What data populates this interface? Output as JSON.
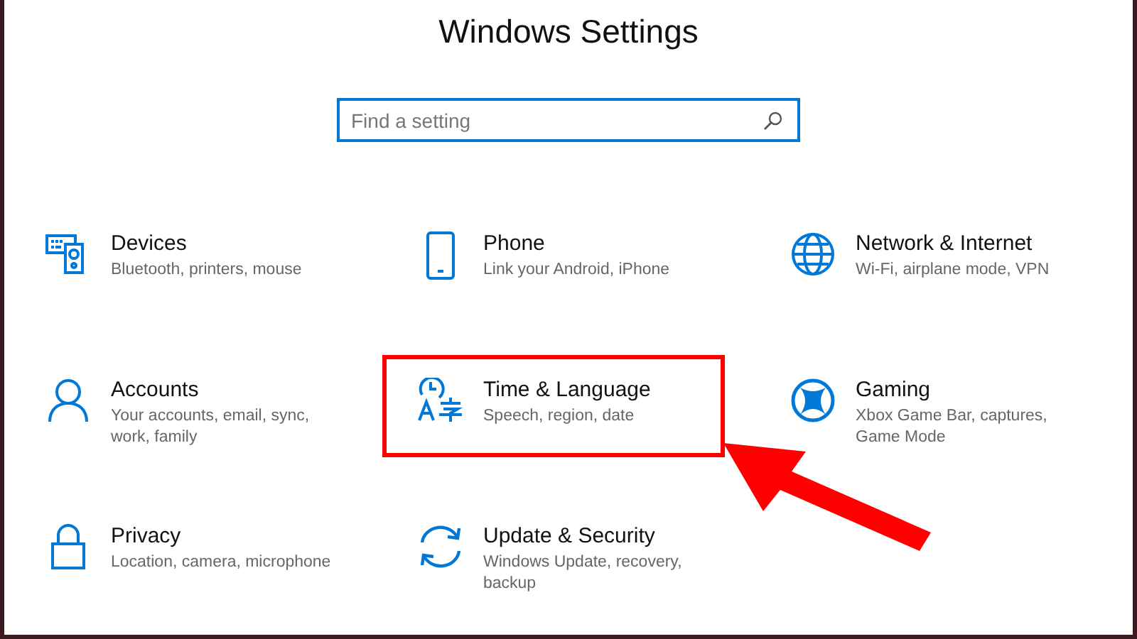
{
  "window": {
    "title": "Windows Settings"
  },
  "search": {
    "placeholder": "Find a setting"
  },
  "items": [
    {
      "kind": "devices",
      "title": "Devices",
      "description": "Bluetooth, printers, mouse",
      "highlighted": false
    },
    {
      "kind": "phone",
      "title": "Phone",
      "description": "Link your Android, iPhone",
      "highlighted": false
    },
    {
      "kind": "network",
      "title": "Network & Internet",
      "description": "Wi-Fi, airplane mode, VPN",
      "highlighted": false
    },
    {
      "kind": "accounts",
      "title": "Accounts",
      "description": "Your accounts, email, sync, work, family",
      "highlighted": false
    },
    {
      "kind": "time",
      "title": "Time & Language",
      "description": "Speech, region, date",
      "highlighted": true
    },
    {
      "kind": "gaming",
      "title": "Gaming",
      "description": "Xbox Game Bar, captures, Game Mode",
      "highlighted": false
    },
    {
      "kind": "privacy",
      "title": "Privacy",
      "description": "Location, camera, microphone",
      "highlighted": false
    },
    {
      "kind": "update",
      "title": "Update & Security",
      "description": "Windows Update, recovery, backup",
      "highlighted": false
    }
  ]
}
